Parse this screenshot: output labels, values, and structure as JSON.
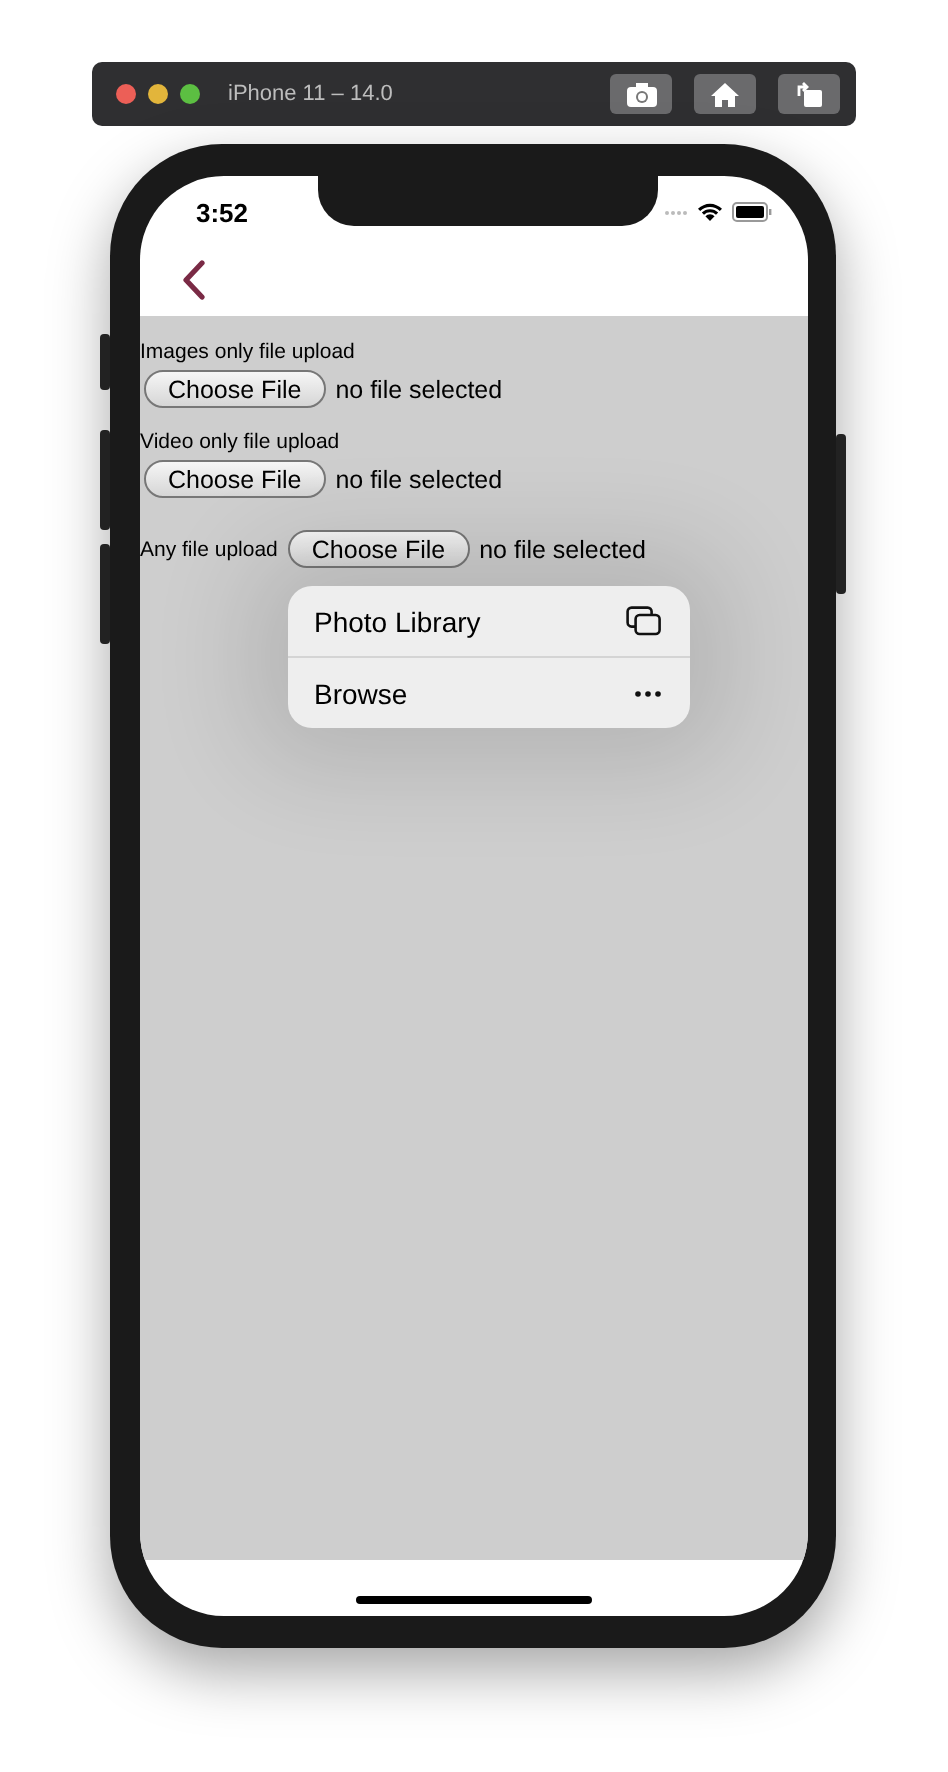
{
  "window": {
    "title": "iPhone 11 – 14.0"
  },
  "status_bar": {
    "time": "3:52"
  },
  "uploads": [
    {
      "label": "Images only file upload",
      "button": "Choose File",
      "status": "no file selected",
      "kind": "stacked"
    },
    {
      "label": "Video only file upload",
      "button": "Choose File",
      "status": "no file selected",
      "kind": "stacked"
    },
    {
      "label": "Any file upload",
      "button": "Choose File",
      "status": "no file selected",
      "kind": "inline"
    }
  ],
  "popup_menu": {
    "items": [
      {
        "label": "Photo Library",
        "kind": "photos"
      },
      {
        "label": "Browse",
        "kind": "more"
      }
    ]
  }
}
